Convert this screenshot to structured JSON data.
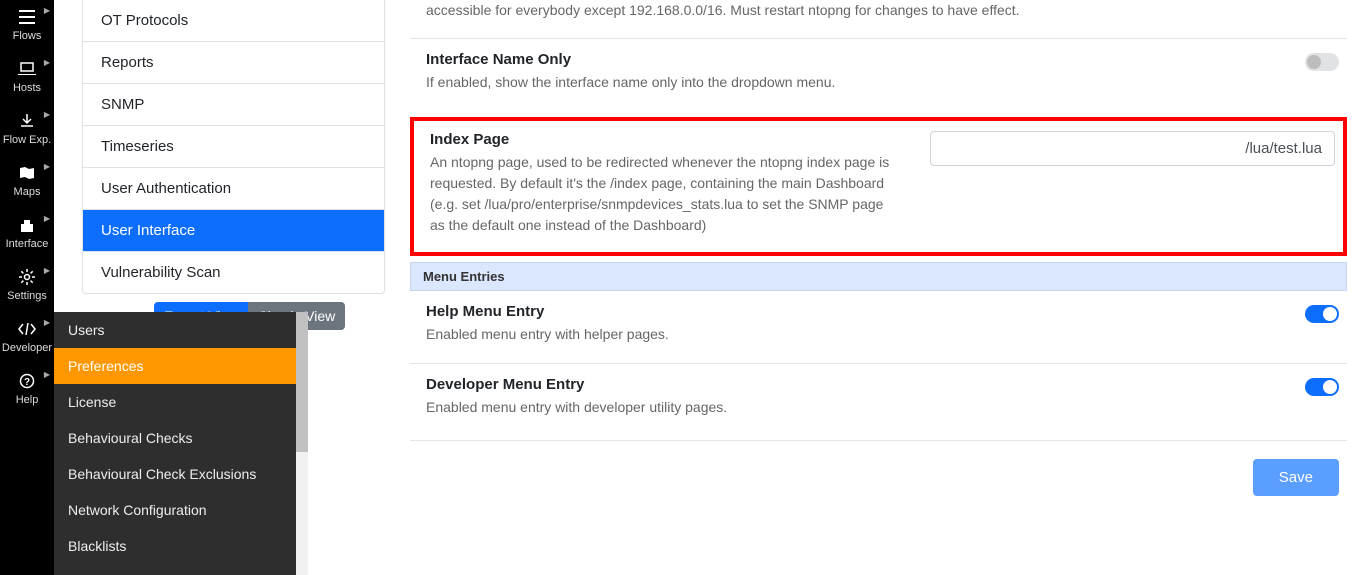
{
  "iconNav": {
    "flows": "Flows",
    "hosts": "Hosts",
    "flowexp": "Flow Exp.",
    "maps": "Maps",
    "interface": "Interface",
    "settings": "Settings",
    "developer": "Developer",
    "help": "Help"
  },
  "submenu": {
    "users": "Users",
    "preferences": "Preferences",
    "license": "License",
    "behaviouralChecks": "Behavioural Checks",
    "behaviouralCheckExclusions": "Behavioural Check Exclusions",
    "networkConfiguration": "Network Configuration",
    "blacklists": "Blacklists"
  },
  "prefSidebar": {
    "otProtocols": "OT Protocols",
    "reports": "Reports",
    "snmp": "SNMP",
    "timeseries": "Timeseries",
    "userAuthentication": "User Authentication",
    "userInterface": "User Interface",
    "vulnerabilityScan": "Vulnerability Scan"
  },
  "viewBtns": {
    "b1": "Expert View",
    "b2": "Simple View"
  },
  "settings": {
    "truncated": "accessible for everybody except 192.168.0.0/16. Must restart ntopng for changes to have effect.",
    "interfaceNameOnly": {
      "title": "Interface Name Only",
      "desc": "If enabled, show the interface name only into the dropdown menu."
    },
    "indexPage": {
      "title": "Index Page",
      "desc": "An ntopng page, used to be redirected whenever the ntopng index page is requested. By default it's the /index page, containing the main Dashboard (e.g. set /lua/pro/enterprise/snmpdevices_stats.lua to set the SNMP page as the default one instead of the Dashboard)",
      "value": "/lua/test.lua"
    },
    "menuEntriesLabel": "Menu Entries",
    "helpMenu": {
      "title": "Help Menu Entry",
      "desc": "Enabled menu entry with helper pages."
    },
    "devMenu": {
      "title": "Developer Menu Entry",
      "desc": "Enabled menu entry with developer utility pages."
    },
    "save": "Save"
  }
}
